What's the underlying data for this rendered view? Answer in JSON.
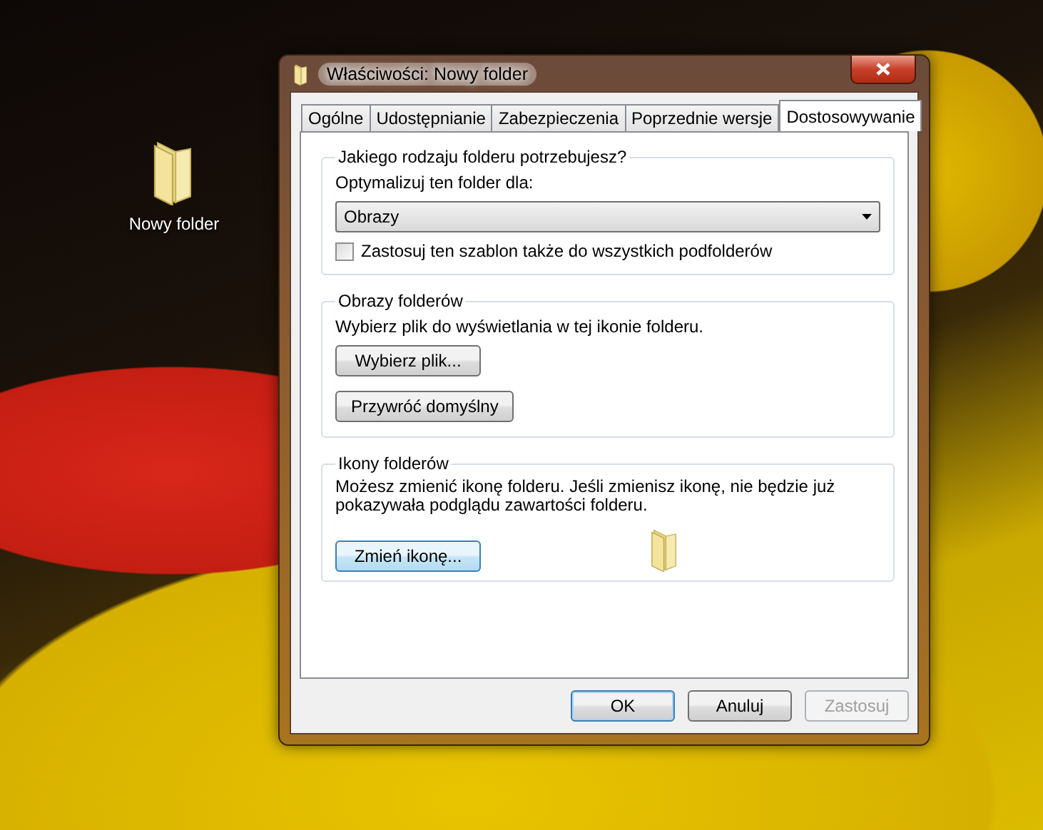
{
  "desktop_icons": [
    {
      "label": "Nowy folder"
    }
  ],
  "window": {
    "title": "Właściwości: Nowy folder",
    "tabs": [
      {
        "label": "Ogólne",
        "selected": false
      },
      {
        "label": "Udostępnianie",
        "selected": false
      },
      {
        "label": "Zabezpieczenia",
        "selected": false
      },
      {
        "label": "Poprzednie wersje",
        "selected": false
      },
      {
        "label": "Dostosowywanie",
        "selected": true
      }
    ],
    "folder_type": {
      "heading": "Jakiego rodzaju folderu potrzebujesz?",
      "label": "Optymalizuj ten folder dla:",
      "dropdown": {
        "value": "Obrazy"
      },
      "checkbox": {
        "label": "Zastosuj ten szablon także do wszystkich podfolderów",
        "checked": false
      }
    },
    "folder_pictures": {
      "heading": "Obrazy folderów",
      "description": "Wybierz plik do wyświetlania w tej ikonie folderu.",
      "buttons": [
        {
          "label": "Wybierz plik..."
        },
        {
          "label": "Przywróć domyślny"
        }
      ]
    },
    "folder_icons": {
      "heading": "Ikony folderów",
      "description": "Możesz zmienić ikonę folderu. Jeśli zmienisz ikonę, nie będzie już pokazywała podglądu zawartości folderu.",
      "button": {
        "label": "Zmień ikonę...",
        "focused": true
      }
    },
    "buttons": [
      {
        "label": "OK",
        "default": true,
        "disabled": false
      },
      {
        "label": "Anuluj",
        "default": false,
        "disabled": false
      },
      {
        "label": "Zastosuj",
        "default": false,
        "disabled": true
      }
    ]
  }
}
